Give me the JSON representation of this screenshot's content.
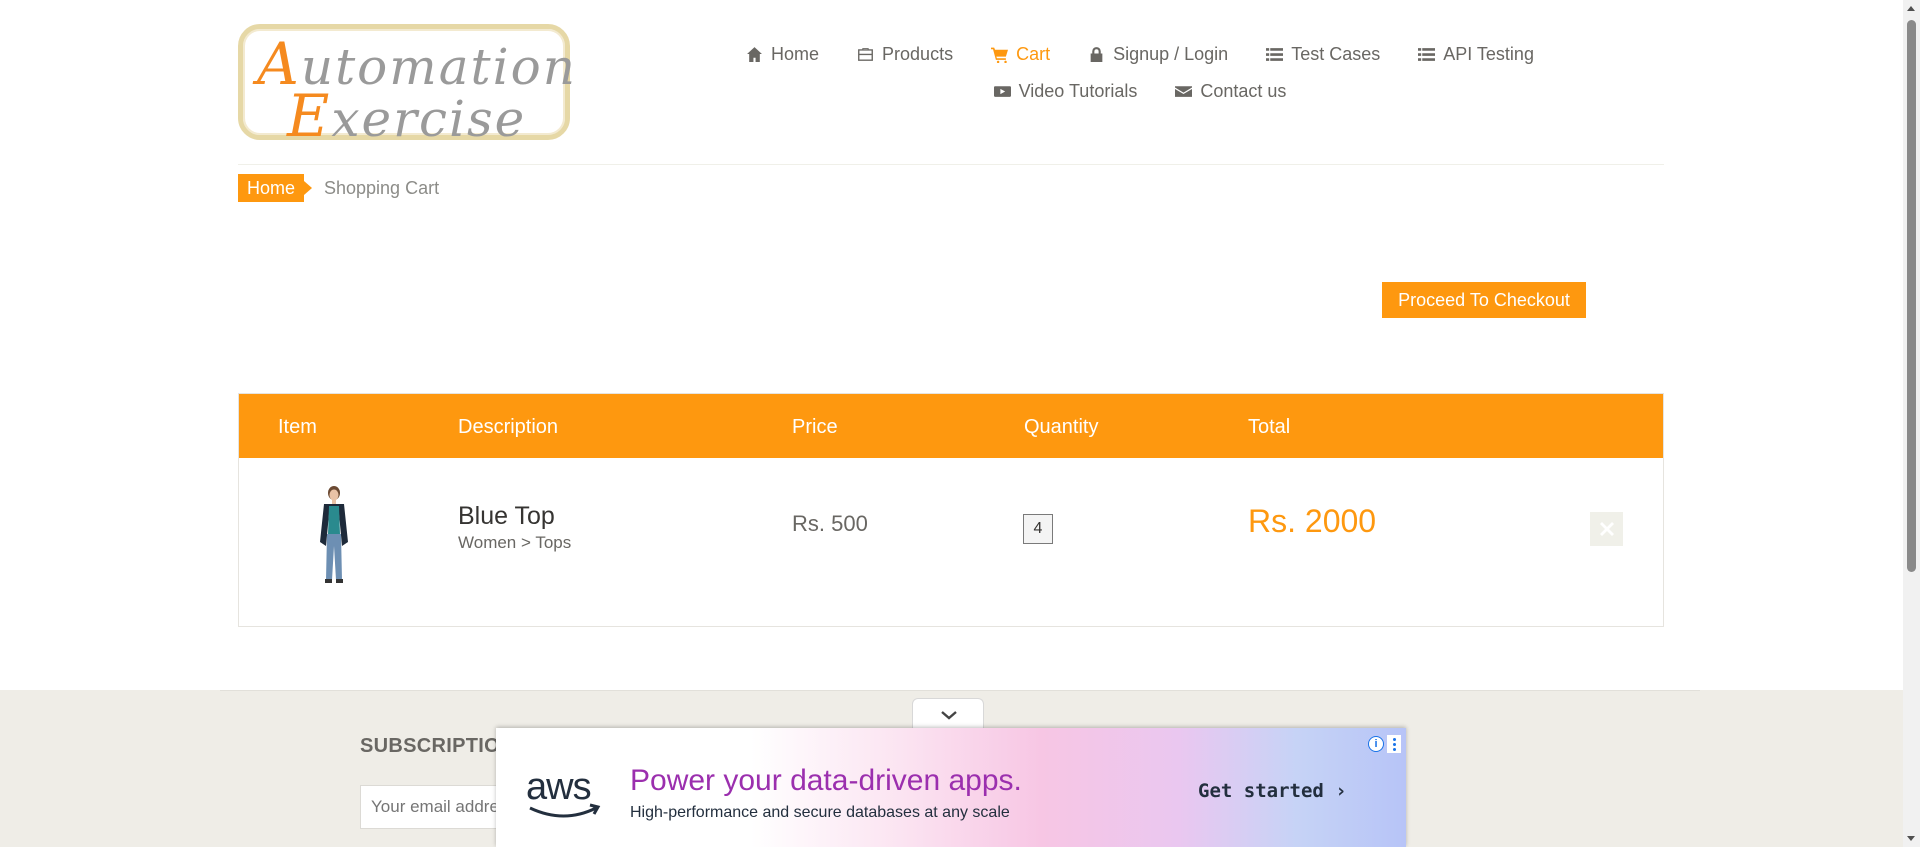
{
  "logo": {
    "line1_cap": "A",
    "line1_rest": "utomation",
    "line2_cap": "E",
    "line2_rest": "xercise"
  },
  "nav": {
    "items": [
      {
        "label": "Home",
        "icon": "home-icon"
      },
      {
        "label": "Products",
        "icon": "briefcase-icon"
      },
      {
        "label": "Cart",
        "icon": "shopping-cart-icon",
        "active": true
      },
      {
        "label": "Signup / Login",
        "icon": "lock-icon"
      },
      {
        "label": "Test Cases",
        "icon": "list-icon"
      },
      {
        "label": "API Testing",
        "icon": "list-icon"
      },
      {
        "label": "Video Tutorials",
        "icon": "youtube-play-icon"
      },
      {
        "label": "Contact us",
        "icon": "envelope-icon"
      }
    ]
  },
  "breadcrumb": {
    "home": "Home",
    "current": "Shopping Cart"
  },
  "checkout_button": "Proceed To Checkout",
  "cart": {
    "headers": {
      "item": "Item",
      "description": "Description",
      "price": "Price",
      "quantity": "Quantity",
      "total": "Total"
    },
    "rows": [
      {
        "name": "Blue Top",
        "category": "Women > Tops",
        "price": "Rs. 500",
        "quantity": "4",
        "total": "Rs. 2000"
      }
    ]
  },
  "subscription": {
    "title": "SUBSCRIPTION",
    "placeholder": "Your email address"
  },
  "ad": {
    "brand": "aws",
    "headline": "Power your data-driven apps.",
    "subline": "High-performance and secure databases at any scale",
    "cta": "Get started ›",
    "info": "i"
  },
  "colors": {
    "accent": "#fe980f",
    "text": "#696763",
    "footer_bg": "#efede7"
  }
}
